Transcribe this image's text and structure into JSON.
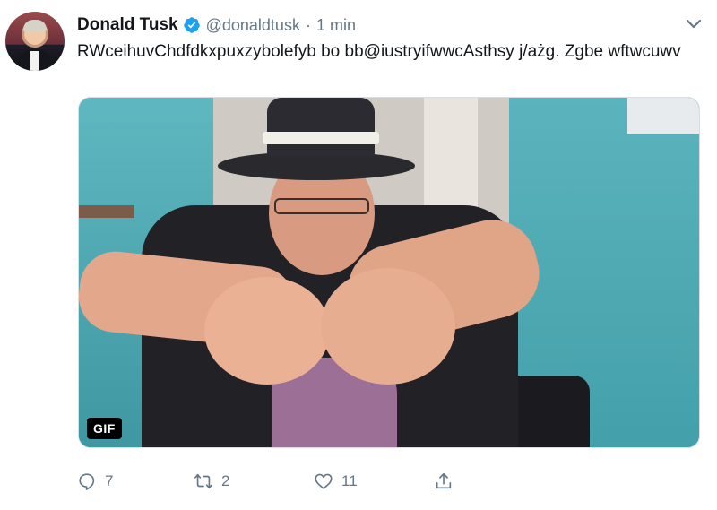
{
  "tweet": {
    "author_name": "Donald Tusk",
    "handle": "@donaldtusk",
    "separator": "·",
    "time": "1 min",
    "text": "RWceihuvChdfdkxpuxzybolefyb bo bb@iustryifwwcAsthsy j/ażg. Zgbe wftwcuwv",
    "media_badge": "GIF"
  },
  "actions": {
    "reply_count": "7",
    "retweet_count": "2",
    "like_count": "11"
  },
  "icons": {
    "verified": "verified-badge-icon",
    "caret": "chevron-down-icon",
    "reply": "reply-icon",
    "retweet": "retweet-icon",
    "like": "heart-icon",
    "share": "share-icon"
  },
  "colors": {
    "verified": "#1da1f2",
    "secondary_text": "#657786",
    "primary_text": "#14171a"
  }
}
